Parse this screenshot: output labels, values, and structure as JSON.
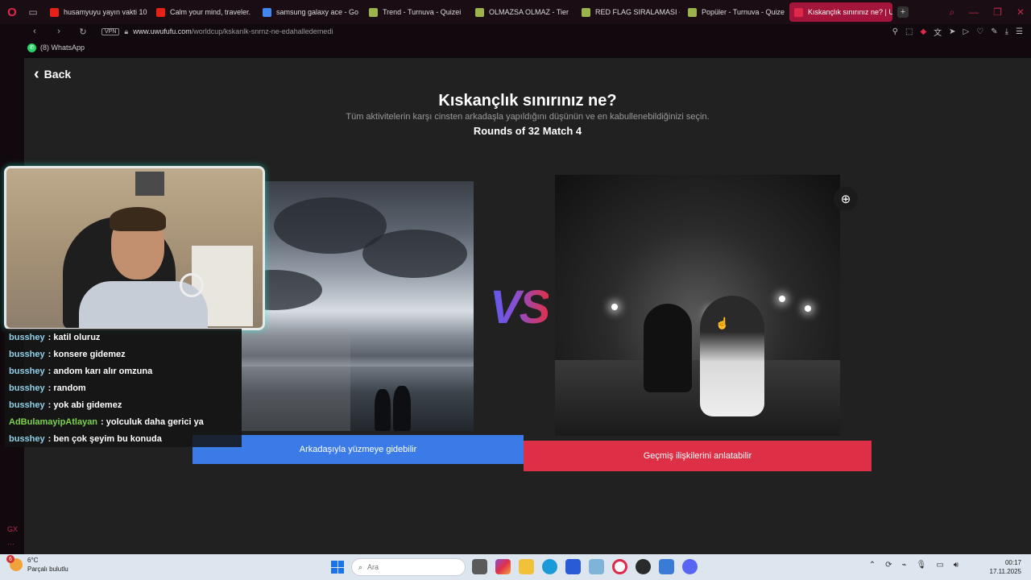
{
  "browser": {
    "tabs": [
      {
        "label": "husamyuyu yayın vakti 10",
        "icon": "youtube-icon",
        "color": "#e62117"
      },
      {
        "label": "Calm your mind, traveler.",
        "icon": "youtube-icon",
        "color": "#e62117"
      },
      {
        "label": "samsung galaxy ace - Go",
        "icon": "google-icon",
        "color": "#4285f4"
      },
      {
        "label": "Trend - Turnuva - Quizei",
        "icon": "quizei-icon",
        "color": "#9ab34a"
      },
      {
        "label": "OLMAZSA OLMAZ - Tier",
        "icon": "quizei-icon",
        "color": "#9ab34a"
      },
      {
        "label": "RED FLAG SIRALAMASI -",
        "icon": "quizei-icon",
        "color": "#9ab34a"
      },
      {
        "label": "Popüler - Turnuva - Quize",
        "icon": "quizei-icon",
        "color": "#9ab34a"
      },
      {
        "label": "Kıskançlık sınırınız ne? | U",
        "icon": "uwufufu-icon",
        "color": "#e0284a",
        "active": true
      }
    ],
    "url_host": "www.uwufufu.com",
    "url_path": "/worldcup/kskanlk-snrnz-ne-edahalledemedi",
    "vpn_label": "VPN",
    "bookmark": "(8) WhatsApp",
    "side_label": "GX"
  },
  "page": {
    "back_label": "Back",
    "title": "Kıskançlık sınırınız ne?",
    "subtitle": "Tüm aktivitelerin karşı cinsten arkadaşla yapıldığını düşünün ve en kabullenebildiğinizi seçin.",
    "rounds": "Rounds of 32 Match 4",
    "vs": "VS",
    "left_choice": "Arkadaşıyla yüzmeye gidebilir",
    "right_choice": "Geçmiş ilişkilerini anlatabilir",
    "accent_left": "#3b7be8",
    "accent_right": "#dd2f45"
  },
  "chat": [
    {
      "user": "busshey",
      "message": ": katil oluruz",
      "color": "#8fd0e8"
    },
    {
      "user": "busshey",
      "message": ": konsere gidemez",
      "color": "#8fd0e8"
    },
    {
      "user": "busshey",
      "message": ": andom karı alır omzuna",
      "color": "#8fd0e8"
    },
    {
      "user": "busshey",
      "message": ": random",
      "color": "#8fd0e8"
    },
    {
      "user": "busshey",
      "message": ": yok abi gidemez",
      "color": "#8fd0e8"
    },
    {
      "user": "AdBulamayipAtlayan",
      "message": ": yolculuk daha gerici ya",
      "color": "#7bd34a"
    },
    {
      "user": "busshey",
      "message": ": ben çok şeyim bu konuda",
      "color": "#8fd0e8"
    }
  ],
  "taskbar": {
    "temperature": "6°C",
    "weather": "Parçalı bulutlu",
    "weather_badge": "6",
    "search_placeholder": "Ara",
    "time": "00:17",
    "date": "17.11.2025"
  }
}
